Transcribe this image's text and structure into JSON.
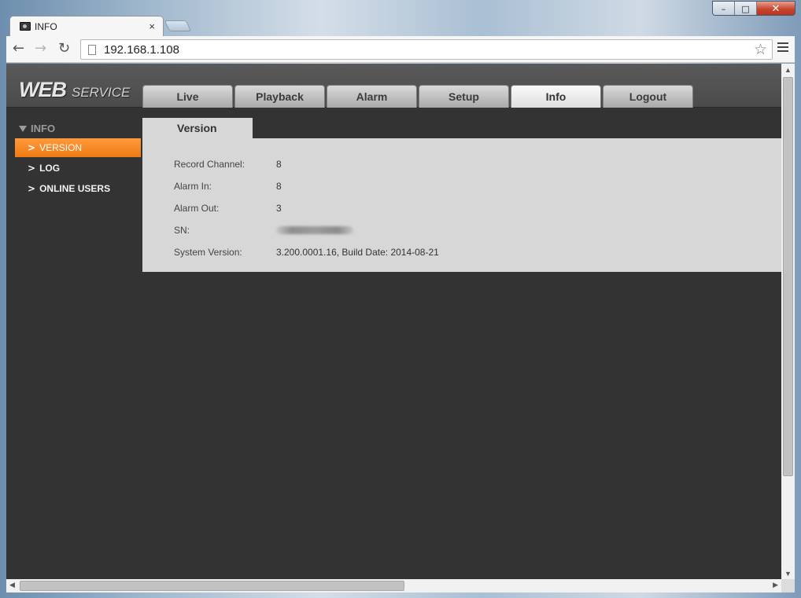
{
  "browser": {
    "tab_title": "INFO",
    "tab_close": "×",
    "url": "192.168.1.108",
    "window_buttons": {
      "minimize": "–",
      "maximize": "□",
      "close": "✕"
    },
    "icons": {
      "back": "arrow-left-icon",
      "forward": "arrow-right-icon",
      "reload": "reload-icon",
      "star": "star-icon",
      "menu": "hamburger-menu-icon"
    }
  },
  "header": {
    "logo_main": "WEB",
    "logo_sub": "SERVICE",
    "tabs": [
      {
        "label": "Live",
        "active": false
      },
      {
        "label": "Playback",
        "active": false
      },
      {
        "label": "Alarm",
        "active": false
      },
      {
        "label": "Setup",
        "active": false
      },
      {
        "label": "Info",
        "active": true
      },
      {
        "label": "Logout",
        "active": false
      }
    ]
  },
  "sidebar": {
    "heading": "INFO",
    "items": [
      {
        "label": "VERSION",
        "active": true
      },
      {
        "label": "LOG",
        "active": false
      },
      {
        "label": "ONLINE USERS",
        "active": false
      }
    ]
  },
  "panel": {
    "tab_label": "Version",
    "rows": [
      {
        "label": "Record Channel:",
        "value": "8"
      },
      {
        "label": "Alarm In:",
        "value": "8"
      },
      {
        "label": "Alarm Out:",
        "value": "3"
      },
      {
        "label": "SN:",
        "value": ""
      },
      {
        "label": "System Version:",
        "value": "3.200.0001.16, Build Date: 2014-08-21"
      }
    ]
  },
  "colors": {
    "accent_orange": "#f07b12",
    "background_dark": "#333333",
    "panel_gray": "#d7d7d7"
  }
}
